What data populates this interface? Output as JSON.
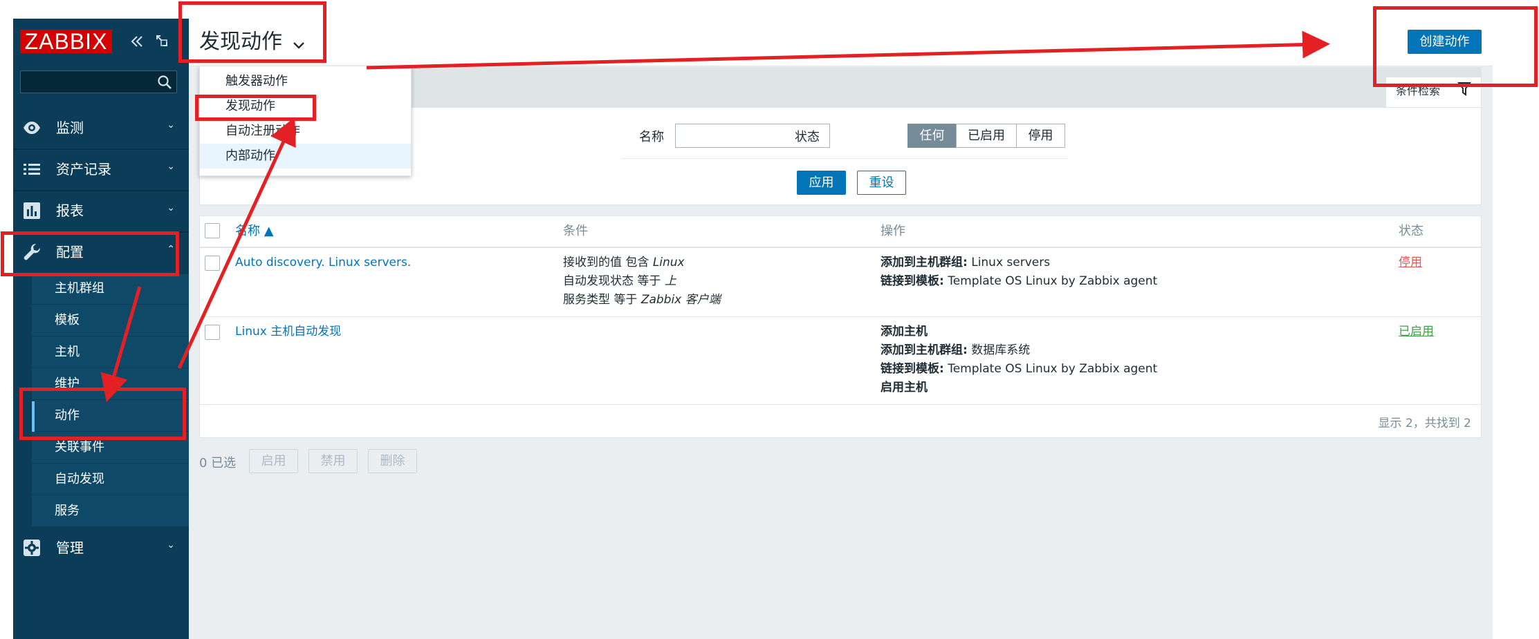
{
  "colors": {
    "sidebar": "#0b3c58",
    "sidebar_sub": "#0f4968",
    "logo_red": "#d40000",
    "primary": "#0275b8",
    "page_bg": "#ebeef0",
    "annotation_red": "#e32124",
    "status_disabled": "#e45959",
    "status_enabled": "#429e47"
  },
  "sidebar": {
    "logo": "ZABBIX",
    "collapse_icon": "double-chevron-left-icon",
    "kiosk_icon": "fullscreen-icon",
    "search_icon": "search-icon",
    "menu": [
      {
        "label": "监测",
        "icon": "eye-icon"
      },
      {
        "label": "资产记录",
        "icon": "list-icon"
      },
      {
        "label": "报表",
        "icon": "bar-chart-icon"
      },
      {
        "label": "配置",
        "icon": "wrench-icon"
      },
      {
        "label": "管理",
        "icon": "gear-icon"
      }
    ],
    "config_submenu": [
      "主机群组",
      "模板",
      "主机",
      "维护",
      "动作",
      "关联事件",
      "自动发现",
      "服务"
    ]
  },
  "header": {
    "title": "发现动作",
    "create_button": "创建动作",
    "title_dropdown": [
      "触发器动作",
      "发现动作",
      "自动注册动作",
      "内部动作"
    ]
  },
  "filter": {
    "tab_label": "条件检索",
    "name_label": "名称",
    "name_value": "",
    "status_label": "状态",
    "status_options": [
      "任何",
      "已启用",
      "停用"
    ],
    "status_selected": "任何",
    "apply": "应用",
    "reset": "重设"
  },
  "table": {
    "columns": [
      "名称 ▲",
      "条件",
      "操作",
      "状态"
    ],
    "rows": [
      {
        "name": "Auto discovery. Linux servers.",
        "conditions": [
          {
            "text": "接收到的值 包含 ",
            "em": "Linux"
          },
          {
            "text": "自动发现状态 等于 ",
            "em": "上"
          },
          {
            "text": "服务类型 等于 ",
            "em": "Zabbix 客户端"
          }
        ],
        "operations": [
          {
            "key": "添加到主机群组:",
            "value": " Linux servers"
          },
          {
            "key": "链接到模板:",
            "value": " Template OS Linux by Zabbix agent"
          }
        ],
        "status": "停用"
      },
      {
        "name": "Linux 主机自动发现",
        "conditions": [],
        "operations": [
          {
            "key": "添加主机",
            "value": ""
          },
          {
            "key": "添加到主机群组:",
            "value": " 数据库系统"
          },
          {
            "key": "链接到模板:",
            "value": " Template OS Linux by Zabbix agent"
          },
          {
            "key": "启用主机",
            "value": ""
          }
        ],
        "status": "已启用"
      }
    ],
    "pager": "显示 2，共找到 2"
  },
  "footer": {
    "selected": "0 已选",
    "buttons": [
      "启用",
      "禁用",
      "删除"
    ]
  }
}
